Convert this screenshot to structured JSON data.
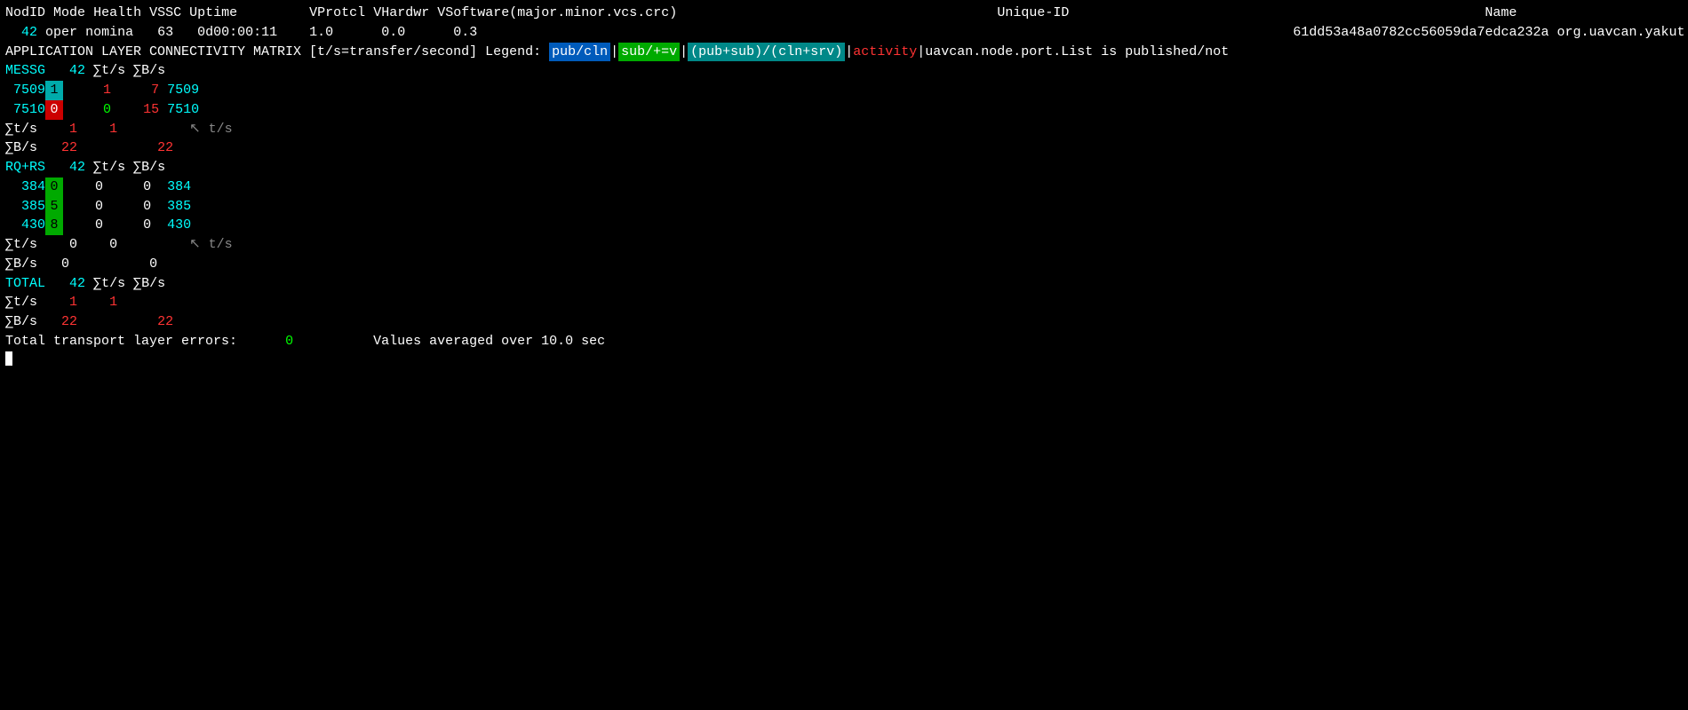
{
  "header": {
    "col_nodeid": "NodID",
    "col_mode": "Mode",
    "col_health": "Health",
    "col_vssc": "VSSC",
    "col_uptime": "Uptime",
    "col_vprotcl": "VProtcl",
    "col_vhardwr": "VHardwr",
    "col_vsoftware": "VSoftware(major.minor.vcs.crc)",
    "col_uniqueid": "Unique-ID",
    "col_name": "Name"
  },
  "node": {
    "nodeid": "42",
    "mode": "oper",
    "health": "nomina",
    "vssc": "63",
    "uptime": "0d00:00:11",
    "vprotcl": "1.0",
    "vhardwr": "0.0",
    "vsoftware": "0.3",
    "uniqueid": "61dd53a48a0782cc56059da7edca232a",
    "name": "org.uavcan.yakut.monitor"
  },
  "legend_line": {
    "prefix": "APPLICATION LAYER CONNECTIVITY MATRIX [t/s=transfer/second] Legend: ",
    "badge1": "pub/cln",
    "badge2": "sub/+=v",
    "badge3": "(pub+sub)/(cln+srv)",
    "activity_label": "activity",
    "suffix": "uavcan.node.port.List is published/not"
  },
  "messg": {
    "label": "MESSG",
    "nodeid": "42",
    "sum_ts": "∑t/s",
    "sum_bs": "∑B/s",
    "rows": [
      {
        "id": "7509",
        "cell_val": "1",
        "cell_color": "cyan",
        "ts": "1",
        "bs": "7",
        "id2": "7509"
      },
      {
        "id": "7510",
        "cell_val": "0",
        "cell_color": "red",
        "ts": "0",
        "bs": "15",
        "id2": "7510"
      }
    ],
    "total_ts_label": "∑t/s",
    "total_ts_val": "1",
    "total_ts_right": "1",
    "total_ts_arrow": "↖ t/s",
    "total_bs_label": "∑B/s",
    "total_bs_val": "22",
    "total_bs_right": "22"
  },
  "rqrs": {
    "label": "RQ+RS",
    "nodeid": "42",
    "sum_ts": "∑t/s",
    "sum_bs": "∑B/s",
    "rows": [
      {
        "id": "384",
        "cell_val": "0",
        "cell_color": "green",
        "ts": "0",
        "bs": "0",
        "id2": "384"
      },
      {
        "id": "385",
        "cell_val": "5",
        "cell_color": "green",
        "ts": "0",
        "bs": "0",
        "id2": "385"
      },
      {
        "id": "430",
        "cell_val": "8",
        "cell_color": "green",
        "ts": "0",
        "bs": "0",
        "id2": "430"
      }
    ],
    "total_ts_label": "∑t/s",
    "total_ts_val": "0",
    "total_ts_right": "0",
    "total_ts_arrow": "↖ t/s",
    "total_bs_label": "∑B/s",
    "total_bs_val": "0",
    "total_bs_right": "0"
  },
  "total": {
    "label": "TOTAL",
    "nodeid": "42",
    "sum_ts": "∑t/s",
    "sum_bs": "∑B/s",
    "ts_label": "∑t/s",
    "ts_val": "1",
    "ts_right": "1",
    "bs_label": "∑B/s",
    "bs_val": "22",
    "bs_right": "22"
  },
  "footer": {
    "errors_label": "Total transport layer errors:",
    "errors_val": "0",
    "avg_label": "Values averaged over 10.0 sec"
  }
}
